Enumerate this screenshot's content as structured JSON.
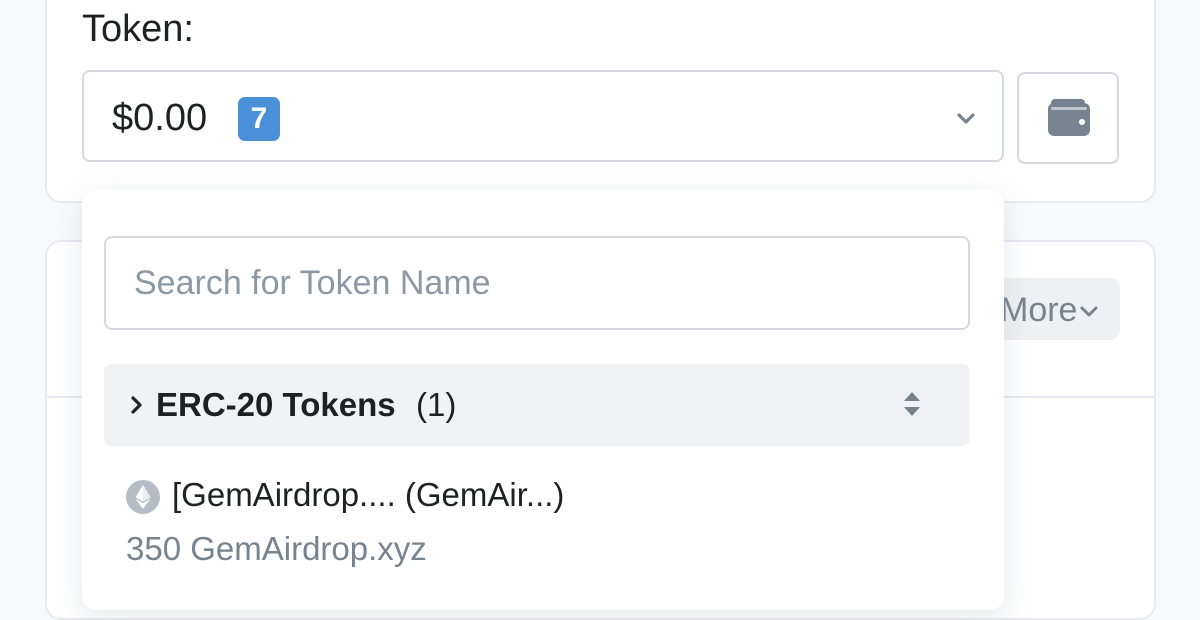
{
  "form": {
    "token_label": "Token:",
    "selected_value": "$0.00",
    "token_count_badge": "7",
    "wallet_icon": "wallet-icon",
    "dropdown_icon": "chevron-down-icon"
  },
  "more_button": {
    "label": "More",
    "icon": "chevron-down-icon"
  },
  "dropdown": {
    "search_placeholder": "Search for Token Name",
    "search_value": "",
    "groups": [
      {
        "name": "ERC-20 Tokens",
        "count": "(1)",
        "expand_icon": "chevron-right-icon",
        "sort_icon": "sort-icon",
        "items": [
          {
            "icon": "ethereum-icon",
            "name": "[GemAirdrop.... (GemAir...)",
            "balance": "350 GemAirdrop.xyz"
          }
        ]
      }
    ]
  },
  "colors": {
    "badge": "#4a90d9",
    "border": "#d5dae2",
    "muted_text": "#77838f",
    "placeholder": "#8c98a4",
    "group_background": "#f1f2f5",
    "page_background": "#f8f9fa"
  }
}
